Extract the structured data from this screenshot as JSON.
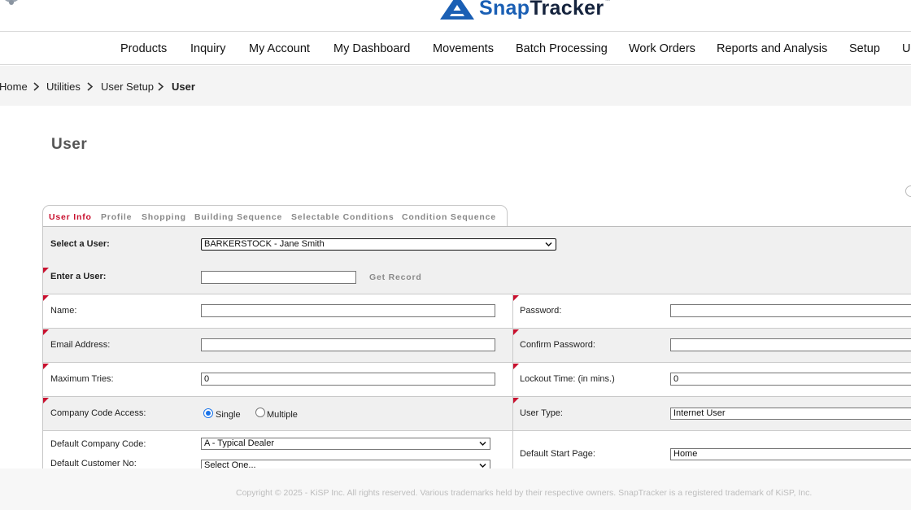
{
  "brand": {
    "name_part1": "Snap",
    "name_part2": "Tracker",
    "trademark": "™",
    "snap_color": "#1a5fb4",
    "accent_red": "#c8102e"
  },
  "header": {
    "icons": [
      "bell-icon",
      "logo-mark"
    ]
  },
  "nav": {
    "items": [
      "Products",
      "Inquiry",
      "My Account",
      "My Dashboard",
      "Movements",
      "Batch Processing",
      "Work Orders",
      "Reports and Analysis",
      "Setup",
      "U"
    ]
  },
  "breadcrumb": {
    "items": [
      "Home",
      "Utilities",
      "User Setup",
      "User"
    ]
  },
  "page": {
    "title": "User"
  },
  "tabs": [
    "User Info",
    "Profile",
    "Shopping",
    "Building Sequence",
    "Selectable Conditions",
    "Condition Sequence"
  ],
  "form": {
    "select_user_label": "Select a User:",
    "select_user_value": "BARKERSTOCK - Jane Smith",
    "enter_user_label": "Enter a User:",
    "enter_user_value": "",
    "get_record_label": "Get Record",
    "name_label": "Name:",
    "name_value": "",
    "password_label": "Password:",
    "password_value": "",
    "email_label": "Email Address:",
    "email_value": "",
    "confirm_password_label": "Confirm Password:",
    "confirm_password_value": "",
    "max_tries_label": "Maximum Tries:",
    "max_tries_value": "0",
    "lockout_label": "Lockout Time: (in mins.)",
    "lockout_value": "0",
    "company_access_label": "Company Code Access:",
    "company_access_options": [
      "Single",
      "Multiple"
    ],
    "company_access_selected": "Single",
    "user_type_label": "User Type:",
    "user_type_value": "Internet User",
    "default_company_label": "Default Company Code:",
    "default_company_value": "A - Typical Dealer",
    "default_customer_label": "Default Customer No:",
    "default_customer_value": "Select One...",
    "default_start_label": "Default Start Page:",
    "default_start_value": "Home"
  },
  "footer": {
    "text": "Copyright © 2025 - KiSP Inc. All rights reserved. Various trademarks held by their respective owners. SnapTracker is a registered trademark of KiSP, Inc."
  }
}
